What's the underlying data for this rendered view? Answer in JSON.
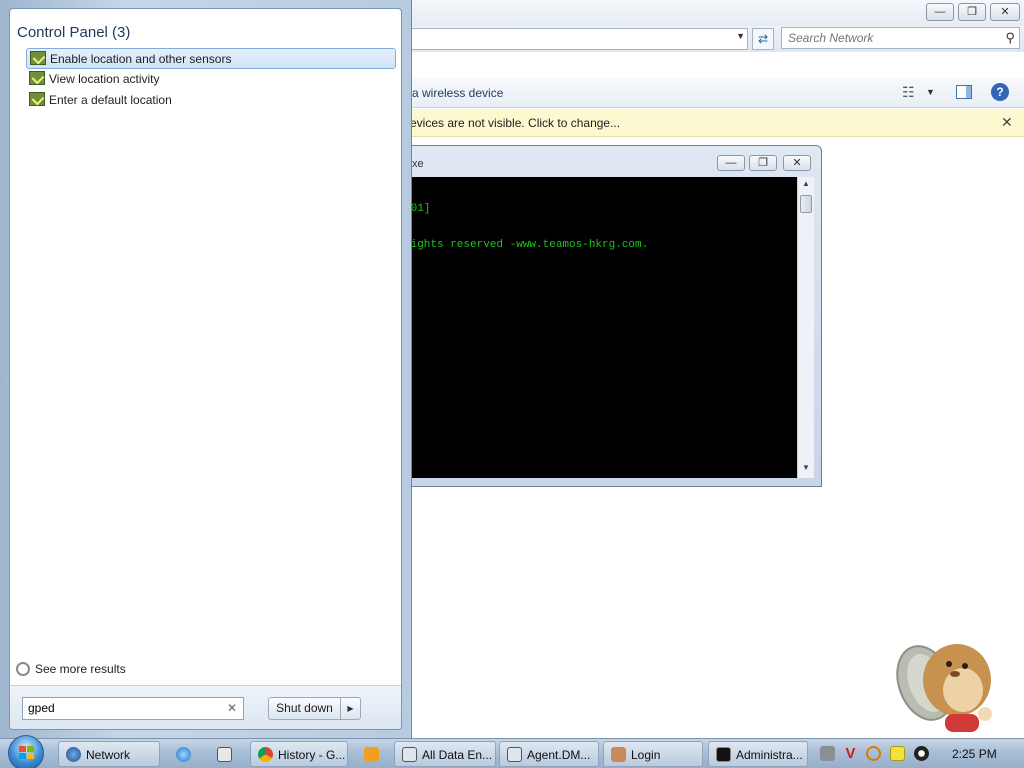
{
  "explorer": {
    "search_placeholder": "Search Network",
    "toolbar_text": "a wireless device",
    "infobar_text": "evices are not visible. Click to change..."
  },
  "console": {
    "title_fragment": "xe",
    "lines": [
      "601]",
      "rights reserved -www.teamos-hkrg.com."
    ]
  },
  "start_menu": {
    "group_title": "Control Panel (3)",
    "results": [
      {
        "label": "Enable location and other sensors",
        "selected": true
      },
      {
        "label": "View location activity",
        "selected": false
      },
      {
        "label": "Enter a default location",
        "selected": false
      }
    ],
    "see_more": "See more results",
    "search_value": "gped",
    "shutdown_label": "Shut down"
  },
  "taskbar": {
    "items": [
      {
        "label": "Network",
        "icon": "network-icon"
      },
      {
        "label": "History - G...",
        "icon": "chrome-icon"
      },
      {
        "label": "All Data En...",
        "icon": "app-window-icon"
      },
      {
        "label": "Agent.DM...",
        "icon": "app-window-icon"
      },
      {
        "label": "Login",
        "icon": "user-icon"
      },
      {
        "label": "Administra...",
        "icon": "cmd-icon"
      }
    ],
    "clock": "2:25 PM"
  },
  "colors": {
    "console_text": "#19c71e",
    "infobar_background": "#fcf8cf",
    "start_menu_title": "#1e395b",
    "selection": "#cfe3f8"
  }
}
